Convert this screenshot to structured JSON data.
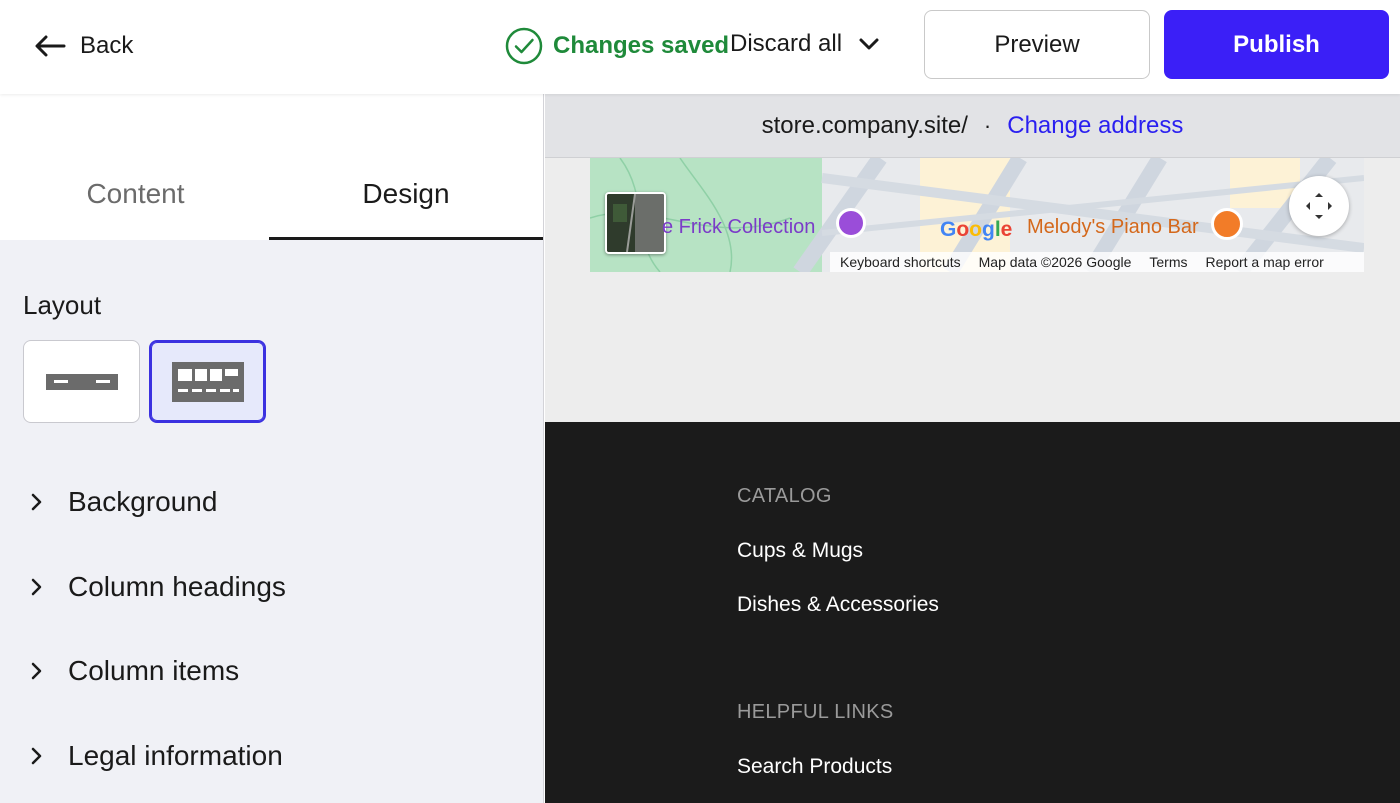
{
  "topbar": {
    "back_label": "Back",
    "status_label": "Changes saved",
    "discard_label": "Discard all",
    "preview_label": "Preview",
    "publish_label": "Publish",
    "accent_color": "#3b1ff7",
    "status_color": "#1f8a3a"
  },
  "tabs": {
    "content_label": "Content",
    "design_label": "Design",
    "active": "Design"
  },
  "design": {
    "layout_title": "Layout",
    "layout_options": [
      "single-row",
      "multi-column"
    ],
    "selected_layout": "multi-column",
    "sections": [
      "Background",
      "Column headings",
      "Column items",
      "Legal information"
    ]
  },
  "preview": {
    "address": "store.company.site/",
    "separator": "·",
    "change_address_label": "Change address",
    "map": {
      "place_1": "e Frick Collection",
      "place_2": "Melody's Piano Bar",
      "brand": "Google",
      "attribution": [
        "Keyboard shortcuts",
        "Map data ©2026 Google",
        "Terms",
        "Report a map error"
      ]
    },
    "footer": {
      "catalog_heading": "CATALOG",
      "catalog_items": [
        "Cups & Mugs",
        "Dishes & Accessories"
      ],
      "links_heading": "HELPFUL LINKS",
      "links_items": [
        "Search Products"
      ]
    }
  }
}
